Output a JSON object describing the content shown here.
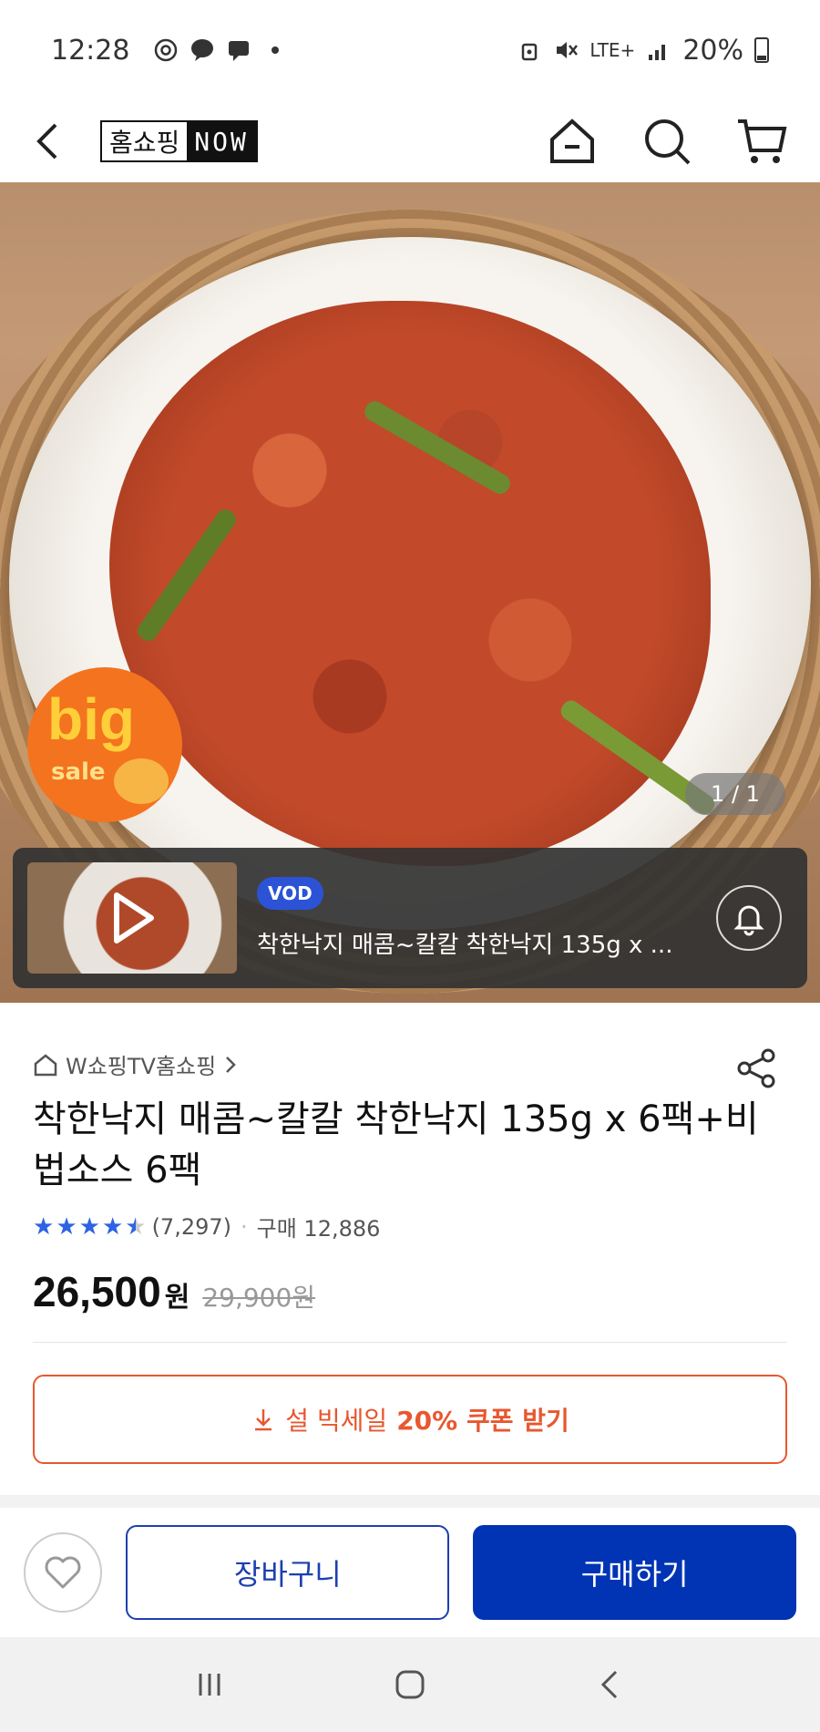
{
  "status_bar": {
    "time": "12:28",
    "network": "LTE+",
    "battery": "20%"
  },
  "header": {
    "logo_left": "홈쇼핑",
    "logo_right": "NOW"
  },
  "hero": {
    "badge_big": "big",
    "badge_sale": "sale",
    "page_indicator": "1 / 1"
  },
  "vod": {
    "badge": "VOD",
    "title": "착한낙지 매콤~칼칼  착한낙지 135g x ..."
  },
  "product": {
    "seller": "W쇼핑TV홈쇼핑",
    "title": "착한낙지 매콤~칼칼  착한낙지 135g x 6팩+비법소스 6팩",
    "rating": 4.5,
    "review_count": "(7,297)",
    "purchase_label": "구매 12,886",
    "price": "26,500",
    "price_unit": "원",
    "original_price": "29,900원"
  },
  "coupon": {
    "prefix": "설 빅세일",
    "bold": "20% 쿠폰 받기"
  },
  "actions": {
    "cart_label": "장바구니",
    "buy_label": "구매하기"
  },
  "colors": {
    "accent": "#0034b4",
    "coupon": "#e8572f",
    "star": "#2d63e3"
  }
}
